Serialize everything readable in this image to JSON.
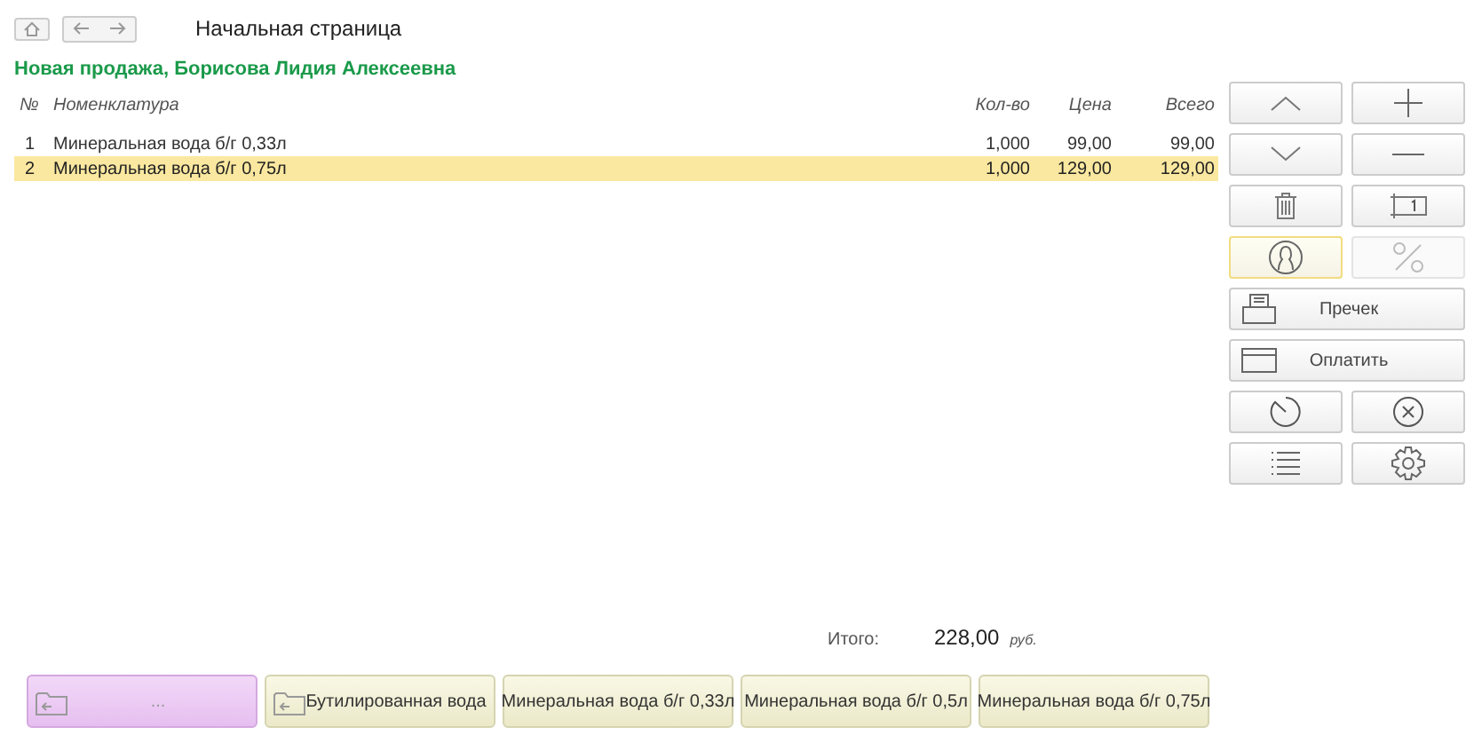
{
  "header": {
    "title": "Начальная страница"
  },
  "document": {
    "title": "Новая продажа, Борисова Лидия Алексеевна"
  },
  "table": {
    "columns": [
      "№",
      "Номенклатура",
      "Кол-во",
      "Цена",
      "Всего"
    ],
    "rows": [
      {
        "no": "1",
        "item": "Минеральная вода б/г 0,33л",
        "qty": "1,000",
        "price": "99,00",
        "total": "99,00",
        "selected": false
      },
      {
        "no": "2",
        "item": "Минеральная вода б/г 0,75л",
        "qty": "1,000",
        "price": "129,00",
        "total": "129,00",
        "selected": true
      }
    ]
  },
  "side_panel": {
    "customer_selected": true,
    "discount_disabled": true,
    "precheck_label": "Пречек",
    "pay_label": "Оплатить"
  },
  "totals": {
    "label": "Итого:",
    "amount": "228,00",
    "currency": "руб."
  },
  "quick_buttons": [
    {
      "kind": "folder",
      "label": "...",
      "selected": true
    },
    {
      "kind": "folder",
      "label": "Бутилированная вода",
      "selected": false
    },
    {
      "kind": "item",
      "label": "Минеральная вода б/г 0,33л",
      "selected": false
    },
    {
      "kind": "item",
      "label": "Минеральная вода б/г 0,5л",
      "selected": false
    },
    {
      "kind": "item",
      "label": "Минеральная вода б/г 0,75л",
      "selected": false
    }
  ]
}
